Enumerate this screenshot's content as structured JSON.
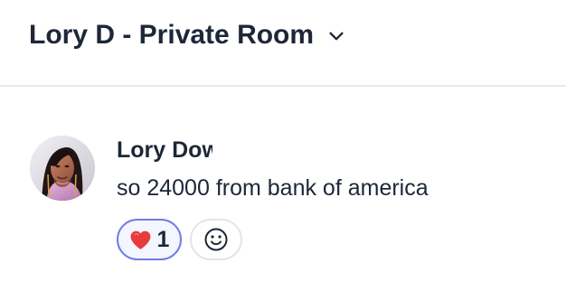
{
  "header": {
    "room_title": "Lory D - Private Room",
    "dropdown_icon": "chevron-down-icon"
  },
  "message": {
    "author": "Lory Dowell",
    "text": "so 24000 from bank of america",
    "avatar_icon": "avatar-photo",
    "reactions": [
      {
        "emoji_icon": "heart-icon",
        "count": "1",
        "selected": true
      }
    ],
    "add_reaction_icon": "smile-face-icon"
  },
  "colors": {
    "text": "#1d2738",
    "divider": "#e6e8ec",
    "selected_reaction_border": "#6f7ddf",
    "selected_reaction_background": "#f3f5ff",
    "add_reaction_border": "#e2e5ea",
    "heart": "#e83b3b"
  }
}
